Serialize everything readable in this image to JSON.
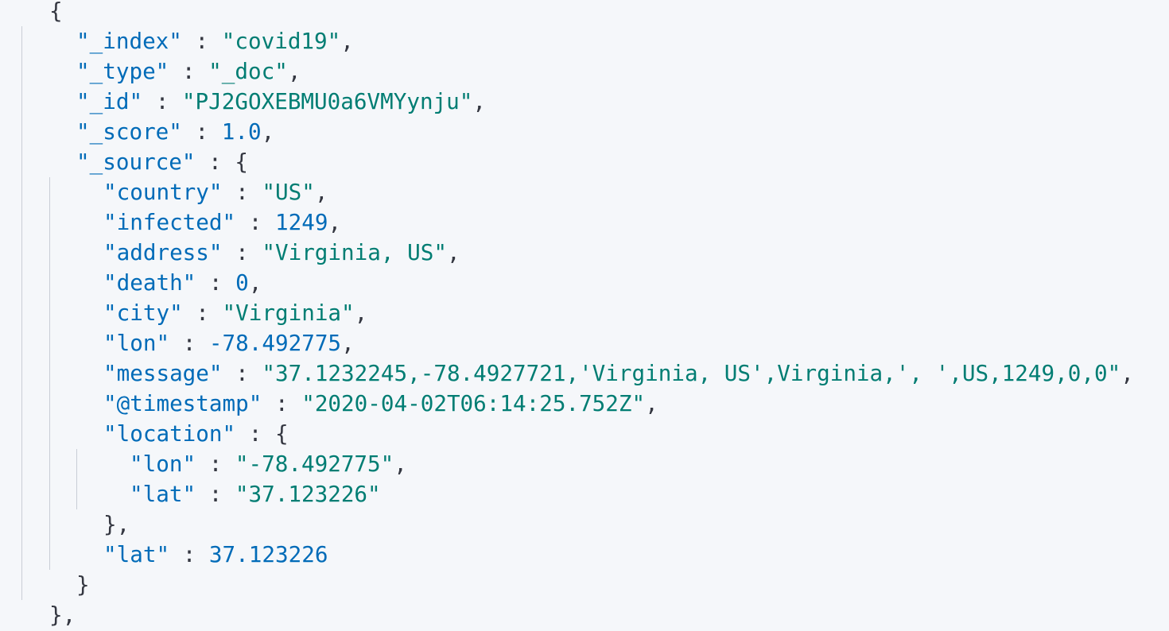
{
  "code_block": {
    "lines": [
      {
        "depth": 1,
        "bracket": "{"
      },
      {
        "depth": 2,
        "key": "\"_index\"",
        "sep": " : ",
        "value": "\"covid19\"",
        "value_type": "string",
        "trail": ","
      },
      {
        "depth": 2,
        "key": "\"_type\"",
        "sep": " : ",
        "value": "\"_doc\"",
        "value_type": "string",
        "trail": ","
      },
      {
        "depth": 2,
        "key": "\"_id\"",
        "sep": " : ",
        "value": "\"PJ2GOXEBMU0a6VMYynju\"",
        "value_type": "string",
        "trail": ","
      },
      {
        "depth": 2,
        "key": "\"_score\"",
        "sep": " : ",
        "value": "1.0",
        "value_type": "number",
        "trail": ","
      },
      {
        "depth": 2,
        "key": "\"_source\"",
        "sep": " : ",
        "bracket": "{"
      },
      {
        "depth": 3,
        "key": "\"country\"",
        "sep": " : ",
        "value": "\"US\"",
        "value_type": "string",
        "trail": ","
      },
      {
        "depth": 3,
        "key": "\"infected\"",
        "sep": " : ",
        "value": "1249",
        "value_type": "number",
        "trail": ","
      },
      {
        "depth": 3,
        "key": "\"address\"",
        "sep": " : ",
        "value": "\"Virginia, US\"",
        "value_type": "string",
        "trail": ","
      },
      {
        "depth": 3,
        "key": "\"death\"",
        "sep": " : ",
        "value": "0",
        "value_type": "number",
        "trail": ","
      },
      {
        "depth": 3,
        "key": "\"city\"",
        "sep": " : ",
        "value": "\"Virginia\"",
        "value_type": "string",
        "trail": ","
      },
      {
        "depth": 3,
        "key": "\"lon\"",
        "sep": " : ",
        "value": "-78.492775",
        "value_type": "number",
        "trail": ","
      },
      {
        "depth": 3,
        "key": "\"message\"",
        "sep": " : ",
        "value": "\"37.1232245,-78.4927721,'Virginia, US',Virginia,', ',US,1249,0,0\"",
        "value_type": "string",
        "trail": ","
      },
      {
        "depth": 3,
        "key": "\"@timestamp\"",
        "sep": " : ",
        "value": "\"2020-04-02T06:14:25.752Z\"",
        "value_type": "string",
        "trail": ","
      },
      {
        "depth": 3,
        "key": "\"location\"",
        "sep": " : ",
        "bracket": "{"
      },
      {
        "depth": 4,
        "key": "\"lon\"",
        "sep": " : ",
        "value": "\"-78.492775\"",
        "value_type": "string",
        "trail": ","
      },
      {
        "depth": 4,
        "key": "\"lat\"",
        "sep": " : ",
        "value": "\"37.123226\"",
        "value_type": "string"
      },
      {
        "depth": 3,
        "bracket": "},"
      },
      {
        "depth": 3,
        "key": "\"lat\"",
        "sep": " : ",
        "value": "37.123226",
        "value_type": "number"
      },
      {
        "depth": 2,
        "bracket": "}"
      },
      {
        "depth": 1,
        "bracket": "},"
      }
    ]
  },
  "colors": {
    "background": "#f5f7fa",
    "key": "#006bb8",
    "string": "#017d73",
    "number": "#006bb8",
    "punctuation": "#343741",
    "indent_guide": "#c9ced6"
  }
}
